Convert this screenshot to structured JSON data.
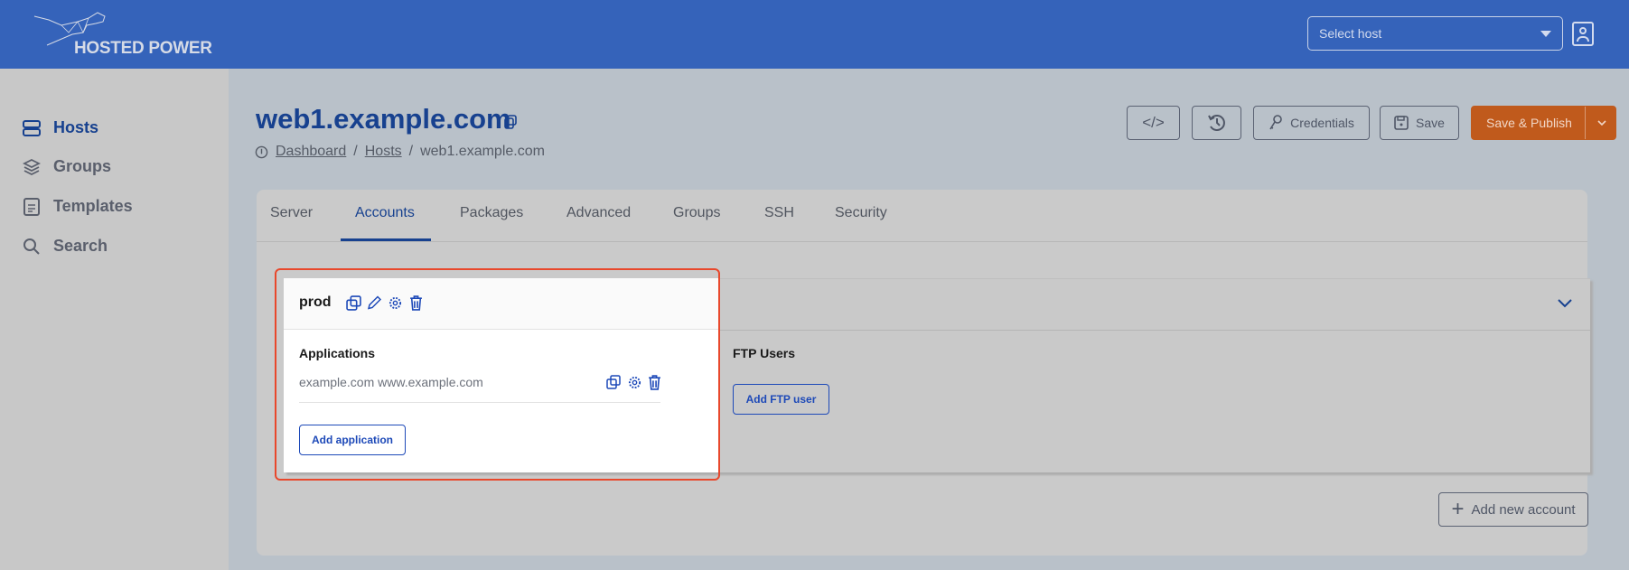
{
  "header": {
    "brand": "HOSTED POWER",
    "host_select_placeholder": "Select host"
  },
  "sidebar": {
    "items": [
      {
        "label": "Hosts",
        "icon": "server-icon",
        "active": true
      },
      {
        "label": "Groups",
        "icon": "layers-icon"
      },
      {
        "label": "Templates",
        "icon": "document-icon"
      },
      {
        "label": "Search",
        "icon": "search-icon"
      }
    ]
  },
  "page": {
    "title": "web1.example.com",
    "breadcrumb": [
      "Dashboard",
      "Hosts",
      "web1.example.com"
    ],
    "separator": "/"
  },
  "toolbar": {
    "credentials": "Credentials",
    "save": "Save",
    "save_publish": "Save & Publish"
  },
  "tabs": [
    "Server",
    "Accounts",
    "Packages",
    "Advanced",
    "Groups",
    "SSH",
    "Security"
  ],
  "active_tab": "Accounts",
  "account": {
    "name": "prod",
    "applications_label": "Applications",
    "application": "example.com www.example.com",
    "add_application": "Add application",
    "ftp_label": "FTP Users",
    "add_ftp": "Add FTP user"
  },
  "add_account": "Add new account",
  "colors": {
    "header": "#3563ba",
    "accent": "#17418f",
    "publish": "#c05a1c",
    "highlight": "#e8482c"
  }
}
